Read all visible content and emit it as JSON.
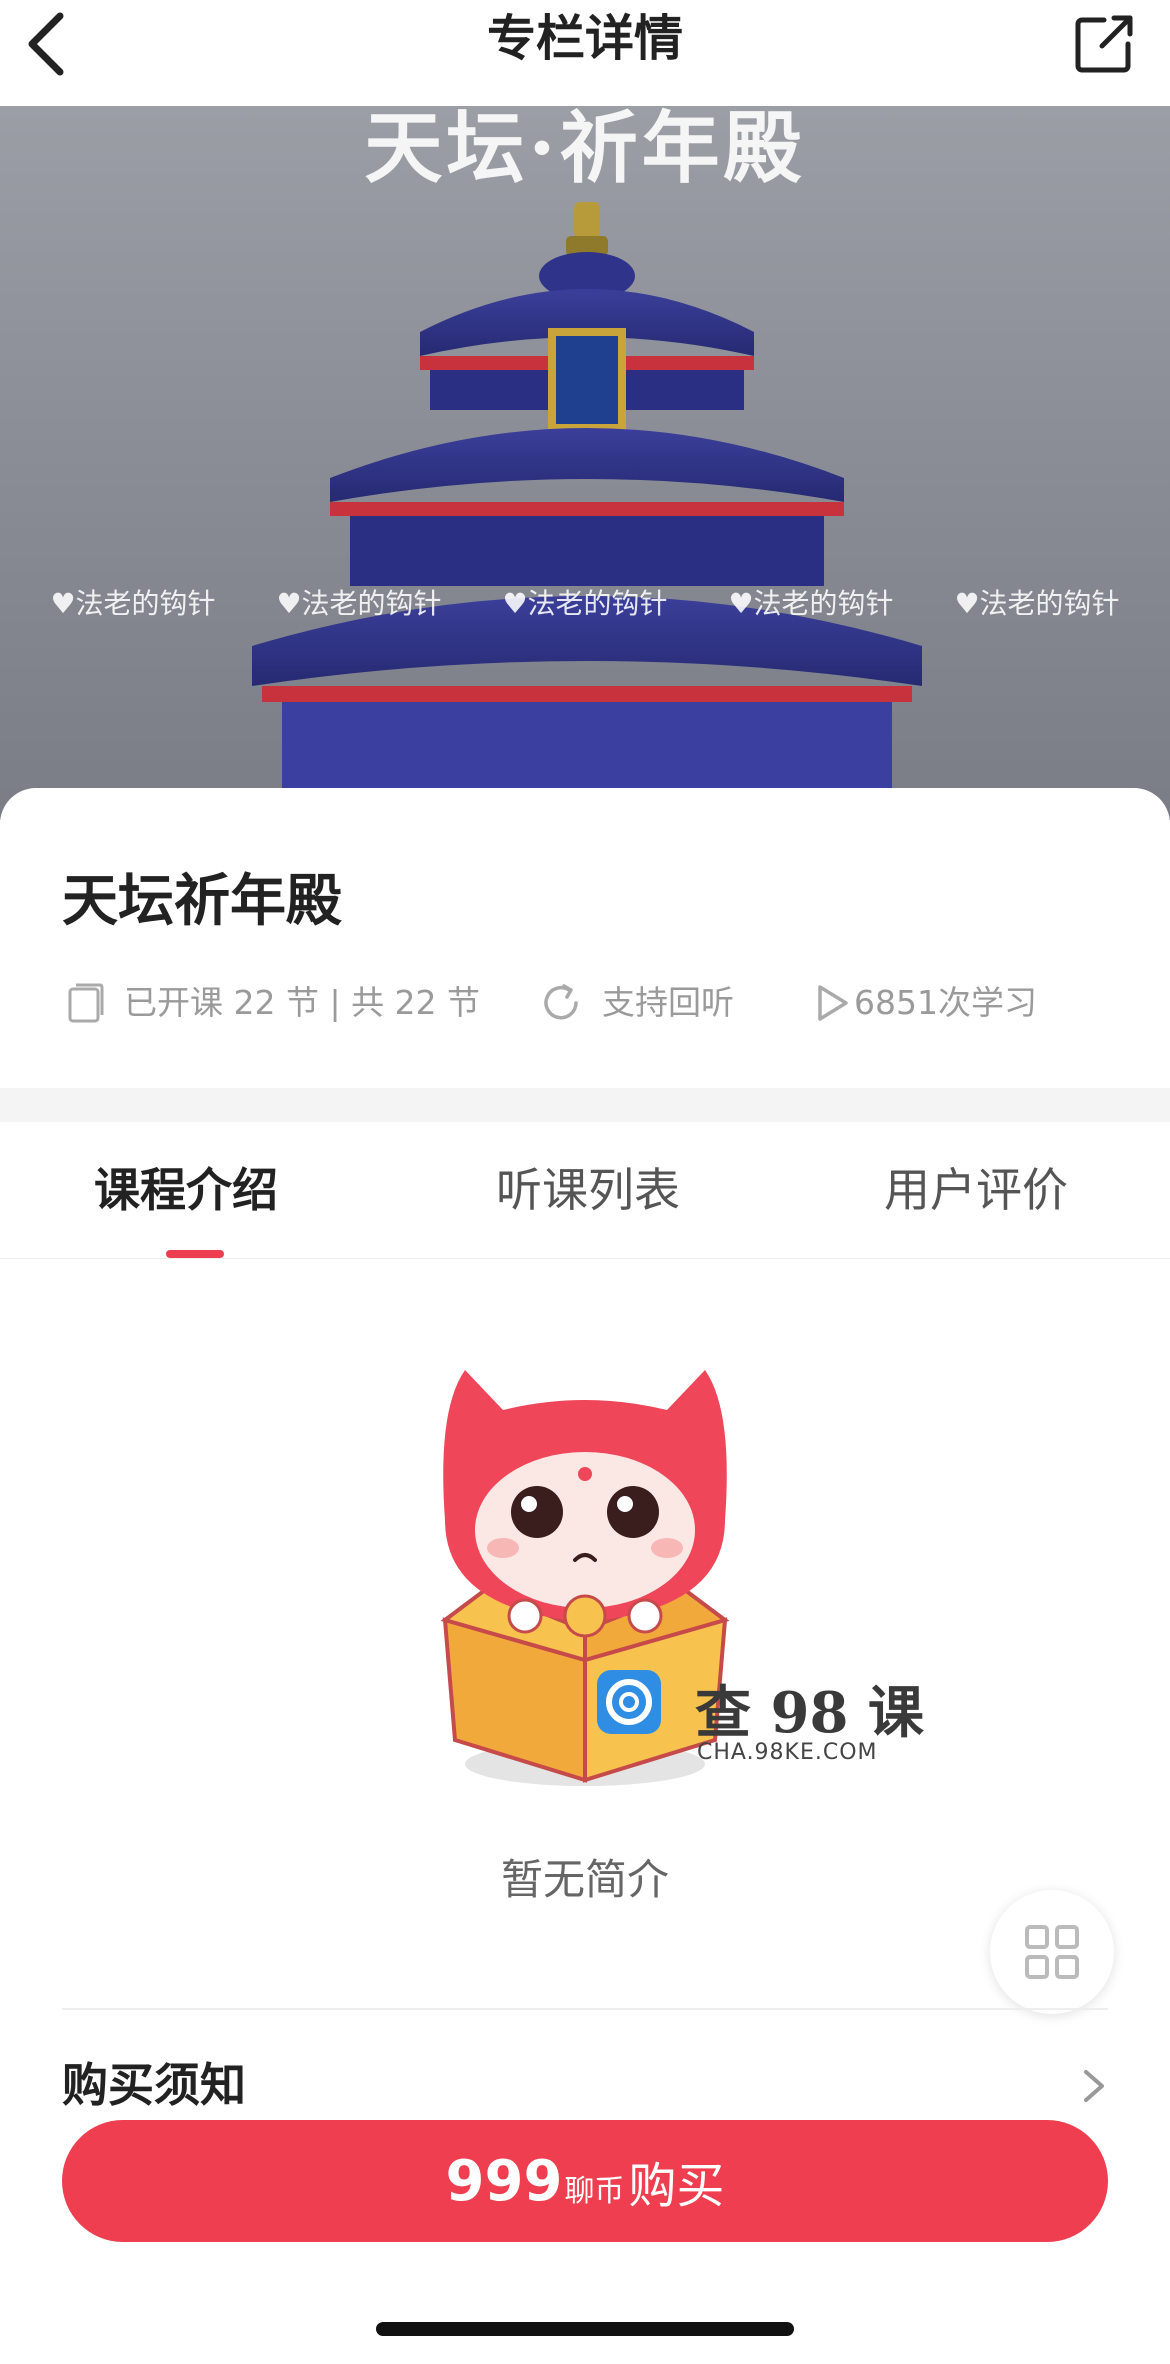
{
  "nav": {
    "title": "专栏详情",
    "back_icon": "chevron-left-icon",
    "share_icon": "share-external-icon"
  },
  "cover": {
    "title_text": "天坛·祈年殿",
    "watermarks": [
      "♥法老的钩针",
      "♥法老的钩针",
      "♥法老的钩针",
      "♥法老的钩针",
      "♥法老的钩针"
    ]
  },
  "course": {
    "title": "天坛祈年殿",
    "lessons": "已开课 22 节 | 共 22 节",
    "replay": "支持回听",
    "study_count": "6851次学习"
  },
  "tabs": [
    {
      "label": "课程介绍",
      "active": true
    },
    {
      "label": "听课列表",
      "active": false
    },
    {
      "label": "用户评价",
      "active": false
    }
  ],
  "empty_state": {
    "text": "暂无简介",
    "watermark_brand": "查 98 课",
    "watermark_url": "CHA.98KE.COM"
  },
  "notice": {
    "label": "购买须知"
  },
  "buy": {
    "price": "999",
    "unit": "聊币",
    "action": "购买"
  },
  "colors": {
    "accent": "#ee3e4f",
    "text_primary": "#222222",
    "text_secondary": "#9a9a9a"
  }
}
